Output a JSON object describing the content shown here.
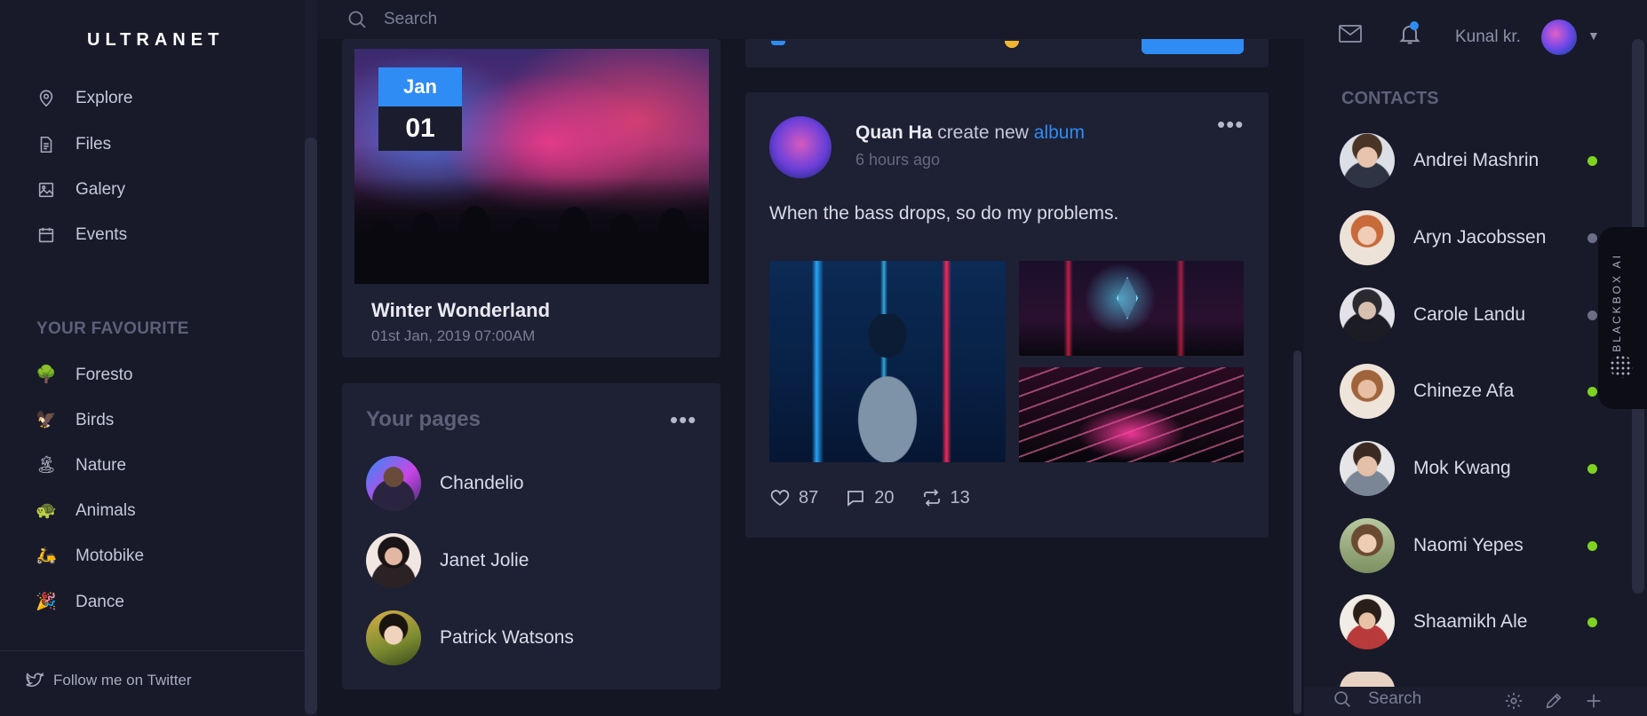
{
  "brand": {
    "logo": "ULTRANET"
  },
  "sidebar": {
    "nav": [
      {
        "label": "Explore",
        "icon": "location-pin-icon"
      },
      {
        "label": "Files",
        "icon": "file-icon"
      },
      {
        "label": "Galery",
        "icon": "image-icon"
      },
      {
        "label": "Events",
        "icon": "calendar-icon"
      }
    ],
    "favourite_title": "YOUR FAVOURITE",
    "favourites": [
      {
        "label": "Foresto",
        "emoji": "🌳"
      },
      {
        "label": "Birds",
        "emoji": "🦅"
      },
      {
        "label": "Nature",
        "emoji": "🏝"
      },
      {
        "label": "Animals",
        "emoji": "🐢"
      },
      {
        "label": "Motobike",
        "emoji": "🛵"
      },
      {
        "label": "Dance",
        "emoji": "🎉"
      }
    ],
    "twitter_label": "Follow me on Twitter"
  },
  "topbar": {
    "search_placeholder": "Search",
    "user_name": "Kunal kr.",
    "caret": "▼"
  },
  "event": {
    "month": "Jan",
    "day": "01",
    "title": "Winter Wonderland",
    "date": "01st Jan, 2019 07:00AM"
  },
  "pages": {
    "title": "Your pages",
    "more": "•••",
    "items": [
      {
        "name": "Chandelio"
      },
      {
        "name": "Janet Jolie"
      },
      {
        "name": "Patrick Watsons"
      }
    ]
  },
  "post": {
    "author": "Quan Ha",
    "action": " create new ",
    "link": "album",
    "time": "6 hours ago",
    "more": "•••",
    "text": "When the bass drops, so do my problems.",
    "likes": "87",
    "comments": "20",
    "shares": "13"
  },
  "contacts": {
    "title": "CONTACTS",
    "items": [
      {
        "name": "Andrei Mashrin",
        "online": true
      },
      {
        "name": "Aryn Jacobssen",
        "online": false
      },
      {
        "name": "Carole Landu",
        "online": false
      },
      {
        "name": "Chineze Afa",
        "online": true
      },
      {
        "name": "Mok Kwang",
        "online": true
      },
      {
        "name": "Naomi Yepes",
        "online": true
      },
      {
        "name": "Shaamikh Ale",
        "online": true
      }
    ],
    "search_placeholder": "Search"
  },
  "blackbox": {
    "label": "BLACKBOX AI"
  },
  "colors": {
    "accent": "#2f8cf5",
    "online": "#7ed321",
    "offline": "#6b6e86",
    "background": "#151623",
    "panel": "#1e2033"
  }
}
